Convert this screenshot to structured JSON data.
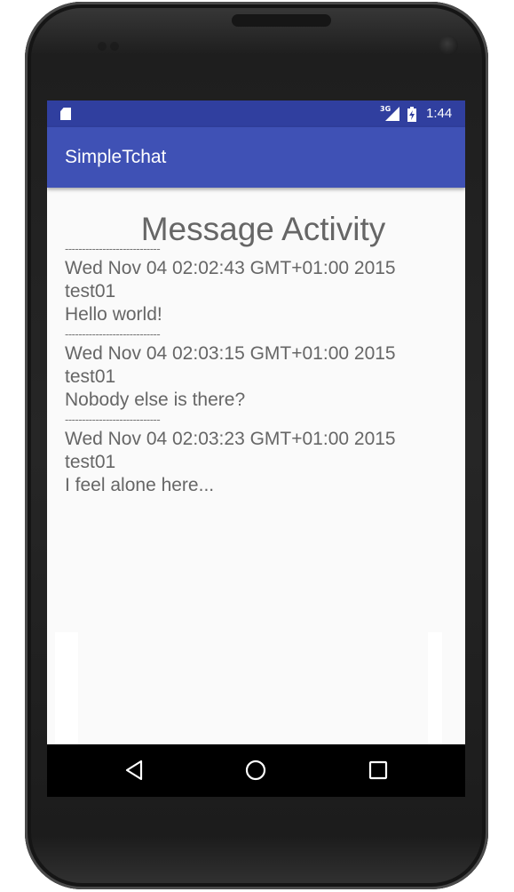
{
  "status_bar": {
    "network": "3G",
    "time": "1:44"
  },
  "app_bar": {
    "title": "SimpleTchat"
  },
  "page": {
    "heading": "Message Activity"
  },
  "messages": [
    {
      "divider": "----------------------------",
      "date": "Wed Nov 04 02:02:43 GMT+01:00 2015",
      "user": "test01",
      "text": "Hello world!"
    },
    {
      "divider": "----------------------------",
      "date": "Wed Nov 04 02:03:15 GMT+01:00 2015",
      "user": "test01",
      "text": "Nobody else is there?"
    },
    {
      "divider": "----------------------------",
      "date": "Wed Nov 04 02:03:23 GMT+01:00 2015",
      "user": "test01",
      "text": "I feel alone here..."
    }
  ],
  "nav_bar": {
    "back_icon": "back-triangle-icon",
    "home_icon": "home-circle-icon",
    "recents_icon": "recents-square-icon"
  },
  "colors": {
    "status_bar": "#303f9f",
    "app_bar": "#3f51b5",
    "text": "#666666",
    "background": "#fafafa"
  }
}
